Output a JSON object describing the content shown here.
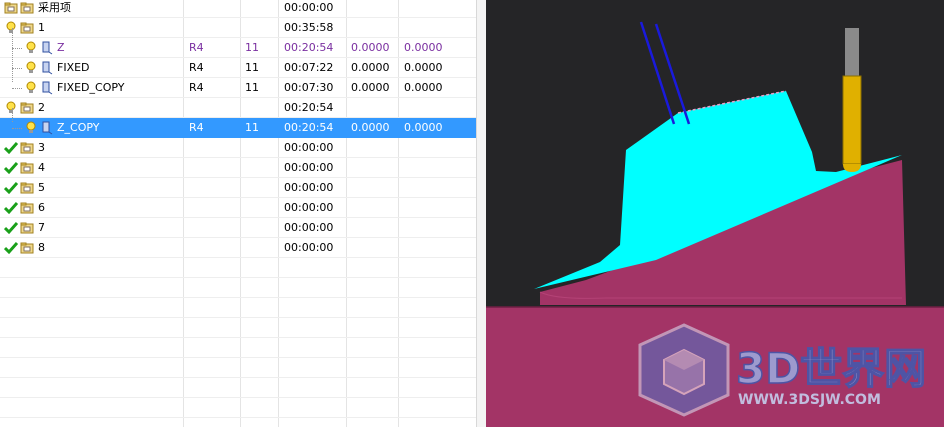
{
  "tree": {
    "rows": [
      {
        "name": "采用项",
        "tool": "",
        "number": "",
        "time": "00:00:00",
        "v1": "",
        "v2": "",
        "status": "folder"
      },
      {
        "name": "1",
        "tool": "",
        "number": "",
        "time": "00:35:58",
        "v1": "",
        "v2": "",
        "status": "warning"
      },
      {
        "name": "Z",
        "tool": "R4",
        "number": "11",
        "time": "00:20:54",
        "v1": "0.0000",
        "v2": "0.0000",
        "status": "warning"
      },
      {
        "name": "FIXED",
        "tool": "R4",
        "number": "11",
        "time": "00:07:22",
        "v1": "0.0000",
        "v2": "0.0000",
        "status": "warning"
      },
      {
        "name": "FIXED_COPY",
        "tool": "R4",
        "number": "11",
        "time": "00:07:30",
        "v1": "0.0000",
        "v2": "0.0000",
        "status": "warning"
      },
      {
        "name": "2",
        "tool": "",
        "number": "",
        "time": "00:20:54",
        "v1": "",
        "v2": "",
        "status": "warning"
      },
      {
        "name": "Z_COPY",
        "tool": "R4",
        "number": "11",
        "time": "00:20:54",
        "v1": "0.0000",
        "v2": "0.0000",
        "status": "warning"
      },
      {
        "name": "3",
        "tool": "",
        "number": "",
        "time": "00:00:00",
        "v1": "",
        "v2": "",
        "status": "ok"
      },
      {
        "name": "4",
        "tool": "",
        "number": "",
        "time": "00:00:00",
        "v1": "",
        "v2": "",
        "status": "ok"
      },
      {
        "name": "5",
        "tool": "",
        "number": "",
        "time": "00:00:00",
        "v1": "",
        "v2": "",
        "status": "ok"
      },
      {
        "name": "6",
        "tool": "",
        "number": "",
        "time": "00:00:00",
        "v1": "",
        "v2": "",
        "status": "ok"
      },
      {
        "name": "7",
        "tool": "",
        "number": "",
        "time": "00:00:00",
        "v1": "",
        "v2": "",
        "status": "ok"
      },
      {
        "name": "8",
        "tool": "",
        "number": "",
        "time": "00:00:00",
        "v1": "",
        "v2": "",
        "status": "ok"
      }
    ],
    "selected_row": "Z_COPY",
    "highlight_color": "#3399ff",
    "purple_text_color": "#7a2fa0"
  },
  "viewport": {
    "background_color": "#252527",
    "part_color": "#a33466",
    "toolpath_color": "#00ffff",
    "tool_color": "#e0b000",
    "axis_color": "#1a1adc"
  },
  "watermark": {
    "brand": "3D世界网",
    "url": "WWW.3DSJW.COM"
  },
  "icons": {
    "folder": "folder-icon",
    "warning": "warning-bulb-icon",
    "ok": "checkmark-icon",
    "operation": "toolpath-operation-icon"
  }
}
